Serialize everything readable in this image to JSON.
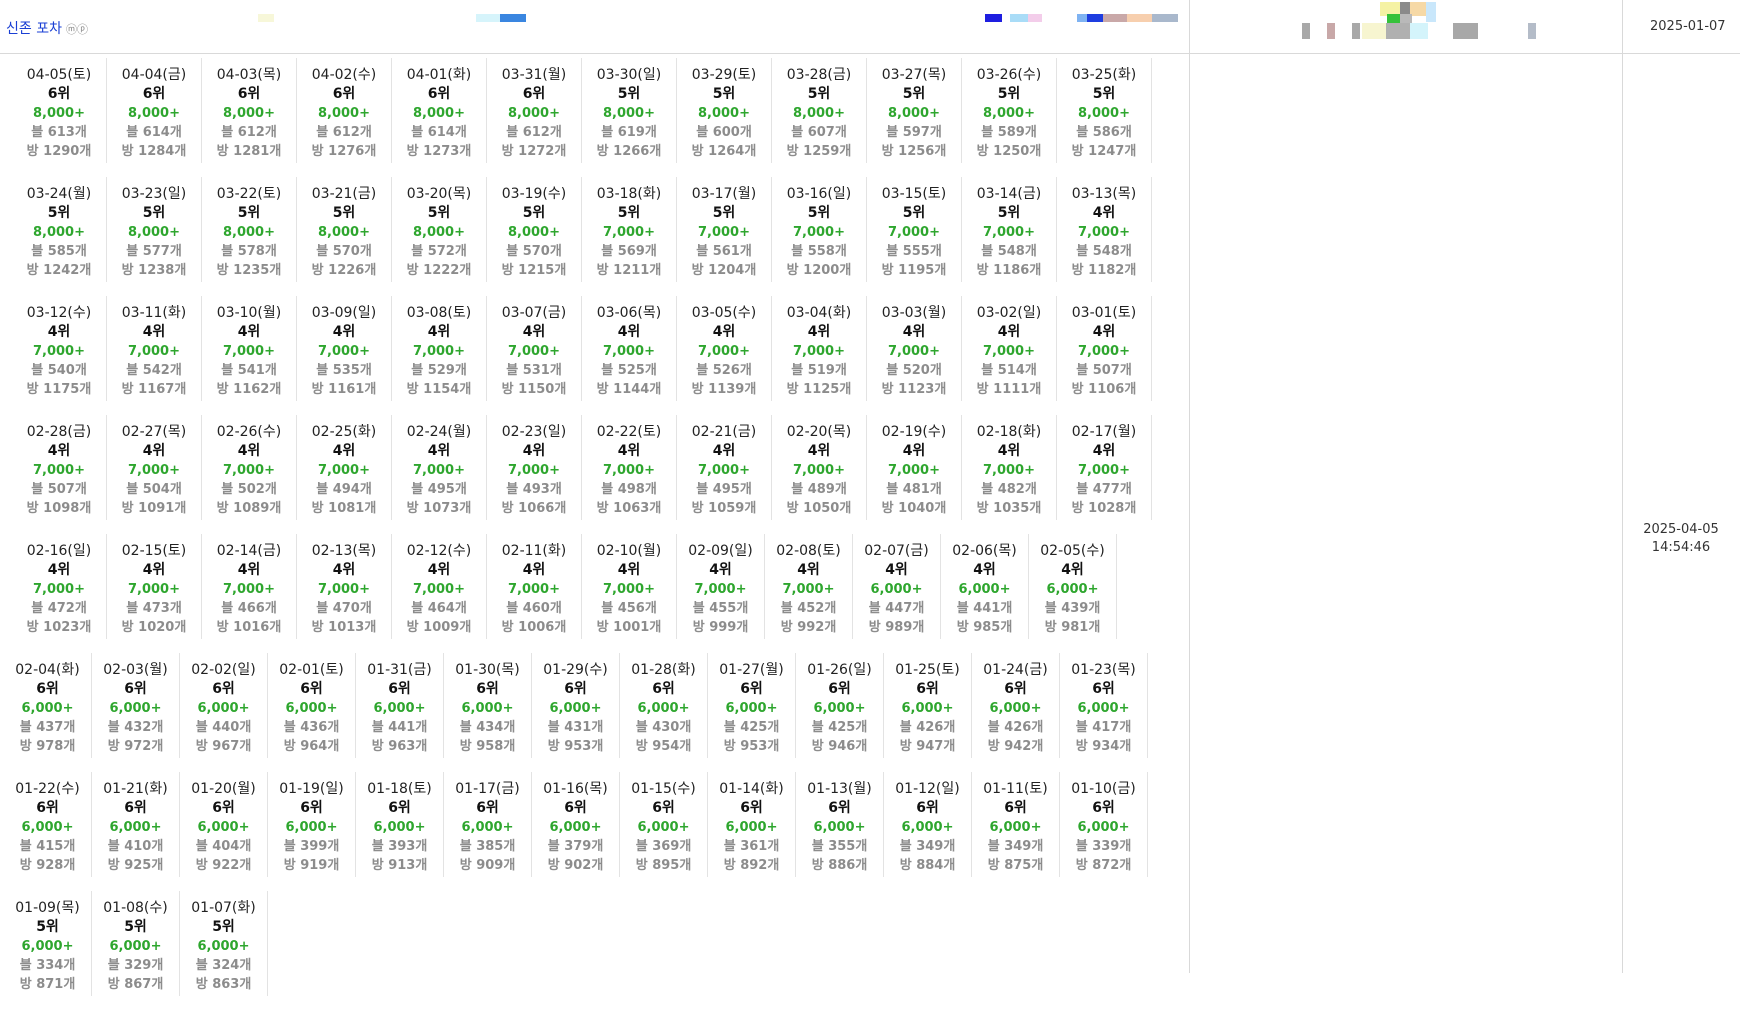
{
  "header": {
    "title": "신존 포차",
    "title_mark": "ⓜⓟ",
    "date": "2025-01-07"
  },
  "timestamp": {
    "date": "2025-04-05",
    "time": "14:54:46"
  },
  "rows": [
    [
      {
        "date": "04-05(토)",
        "rank": "6위",
        "value": "8,000+",
        "blog": "블 613개",
        "room": "방 1290개"
      },
      {
        "date": "04-04(금)",
        "rank": "6위",
        "value": "8,000+",
        "blog": "블 614개",
        "room": "방 1284개"
      },
      {
        "date": "04-03(목)",
        "rank": "6위",
        "value": "8,000+",
        "blog": "블 612개",
        "room": "방 1281개"
      },
      {
        "date": "04-02(수)",
        "rank": "6위",
        "value": "8,000+",
        "blog": "블 612개",
        "room": "방 1276개"
      },
      {
        "date": "04-01(화)",
        "rank": "6위",
        "value": "8,000+",
        "blog": "블 614개",
        "room": "방 1273개"
      },
      {
        "date": "03-31(월)",
        "rank": "6위",
        "value": "8,000+",
        "blog": "블 612개",
        "room": "방 1272개"
      },
      {
        "date": "03-30(일)",
        "rank": "5위",
        "value": "8,000+",
        "blog": "블 619개",
        "room": "방 1266개"
      },
      {
        "date": "03-29(토)",
        "rank": "5위",
        "value": "8,000+",
        "blog": "블 600개",
        "room": "방 1264개"
      },
      {
        "date": "03-28(금)",
        "rank": "5위",
        "value": "8,000+",
        "blog": "블 607개",
        "room": "방 1259개"
      },
      {
        "date": "03-27(목)",
        "rank": "5위",
        "value": "8,000+",
        "blog": "블 597개",
        "room": "방 1256개"
      },
      {
        "date": "03-26(수)",
        "rank": "5위",
        "value": "8,000+",
        "blog": "블 589개",
        "room": "방 1250개"
      },
      {
        "date": "03-25(화)",
        "rank": "5위",
        "value": "8,000+",
        "blog": "블 586개",
        "room": "방 1247개"
      }
    ],
    [
      {
        "date": "03-24(월)",
        "rank": "5위",
        "value": "8,000+",
        "blog": "블 585개",
        "room": "방 1242개"
      },
      {
        "date": "03-23(일)",
        "rank": "5위",
        "value": "8,000+",
        "blog": "블 577개",
        "room": "방 1238개"
      },
      {
        "date": "03-22(토)",
        "rank": "5위",
        "value": "8,000+",
        "blog": "블 578개",
        "room": "방 1235개"
      },
      {
        "date": "03-21(금)",
        "rank": "5위",
        "value": "8,000+",
        "blog": "블 570개",
        "room": "방 1226개"
      },
      {
        "date": "03-20(목)",
        "rank": "5위",
        "value": "8,000+",
        "blog": "블 572개",
        "room": "방 1222개"
      },
      {
        "date": "03-19(수)",
        "rank": "5위",
        "value": "8,000+",
        "blog": "블 570개",
        "room": "방 1215개"
      },
      {
        "date": "03-18(화)",
        "rank": "5위",
        "value": "7,000+",
        "blog": "블 569개",
        "room": "방 1211개"
      },
      {
        "date": "03-17(월)",
        "rank": "5위",
        "value": "7,000+",
        "blog": "블 561개",
        "room": "방 1204개"
      },
      {
        "date": "03-16(일)",
        "rank": "5위",
        "value": "7,000+",
        "blog": "블 558개",
        "room": "방 1200개"
      },
      {
        "date": "03-15(토)",
        "rank": "5위",
        "value": "7,000+",
        "blog": "블 555개",
        "room": "방 1195개"
      },
      {
        "date": "03-14(금)",
        "rank": "5위",
        "value": "7,000+",
        "blog": "블 548개",
        "room": "방 1186개"
      },
      {
        "date": "03-13(목)",
        "rank": "4위",
        "value": "7,000+",
        "blog": "블 548개",
        "room": "방 1182개"
      }
    ],
    [
      {
        "date": "03-12(수)",
        "rank": "4위",
        "value": "7,000+",
        "blog": "블 540개",
        "room": "방 1175개"
      },
      {
        "date": "03-11(화)",
        "rank": "4위",
        "value": "7,000+",
        "blog": "블 542개",
        "room": "방 1167개"
      },
      {
        "date": "03-10(월)",
        "rank": "4위",
        "value": "7,000+",
        "blog": "블 541개",
        "room": "방 1162개"
      },
      {
        "date": "03-09(일)",
        "rank": "4위",
        "value": "7,000+",
        "blog": "블 535개",
        "room": "방 1161개"
      },
      {
        "date": "03-08(토)",
        "rank": "4위",
        "value": "7,000+",
        "blog": "블 529개",
        "room": "방 1154개"
      },
      {
        "date": "03-07(금)",
        "rank": "4위",
        "value": "7,000+",
        "blog": "블 531개",
        "room": "방 1150개"
      },
      {
        "date": "03-06(목)",
        "rank": "4위",
        "value": "7,000+",
        "blog": "블 525개",
        "room": "방 1144개"
      },
      {
        "date": "03-05(수)",
        "rank": "4위",
        "value": "7,000+",
        "blog": "블 526개",
        "room": "방 1139개"
      },
      {
        "date": "03-04(화)",
        "rank": "4위",
        "value": "7,000+",
        "blog": "블 519개",
        "room": "방 1125개"
      },
      {
        "date": "03-03(월)",
        "rank": "4위",
        "value": "7,000+",
        "blog": "블 520개",
        "room": "방 1123개"
      },
      {
        "date": "03-02(일)",
        "rank": "4위",
        "value": "7,000+",
        "blog": "블 514개",
        "room": "방 1111개"
      },
      {
        "date": "03-01(토)",
        "rank": "4위",
        "value": "7,000+",
        "blog": "블 507개",
        "room": "방 1106개"
      }
    ],
    [
      {
        "date": "02-28(금)",
        "rank": "4위",
        "value": "7,000+",
        "blog": "블 507개",
        "room": "방 1098개"
      },
      {
        "date": "02-27(목)",
        "rank": "4위",
        "value": "7,000+",
        "blog": "블 504개",
        "room": "방 1091개"
      },
      {
        "date": "02-26(수)",
        "rank": "4위",
        "value": "7,000+",
        "blog": "블 502개",
        "room": "방 1089개"
      },
      {
        "date": "02-25(화)",
        "rank": "4위",
        "value": "7,000+",
        "blog": "블 494개",
        "room": "방 1081개"
      },
      {
        "date": "02-24(월)",
        "rank": "4위",
        "value": "7,000+",
        "blog": "블 495개",
        "room": "방 1073개"
      },
      {
        "date": "02-23(일)",
        "rank": "4위",
        "value": "7,000+",
        "blog": "블 493개",
        "room": "방 1066개"
      },
      {
        "date": "02-22(토)",
        "rank": "4위",
        "value": "7,000+",
        "blog": "블 498개",
        "room": "방 1063개"
      },
      {
        "date": "02-21(금)",
        "rank": "4위",
        "value": "7,000+",
        "blog": "블 495개",
        "room": "방 1059개"
      },
      {
        "date": "02-20(목)",
        "rank": "4위",
        "value": "7,000+",
        "blog": "블 489개",
        "room": "방 1050개"
      },
      {
        "date": "02-19(수)",
        "rank": "4위",
        "value": "7,000+",
        "blog": "블 481개",
        "room": "방 1040개"
      },
      {
        "date": "02-18(화)",
        "rank": "4위",
        "value": "7,000+",
        "blog": "블 482개",
        "room": "방 1035개"
      },
      {
        "date": "02-17(월)",
        "rank": "4위",
        "value": "7,000+",
        "blog": "블 477개",
        "room": "방 1028개"
      }
    ],
    [
      {
        "date": "02-16(일)",
        "rank": "4위",
        "value": "7,000+",
        "blog": "블 472개",
        "room": "방 1023개"
      },
      {
        "date": "02-15(토)",
        "rank": "4위",
        "value": "7,000+",
        "blog": "블 473개",
        "room": "방 1020개"
      },
      {
        "date": "02-14(금)",
        "rank": "4위",
        "value": "7,000+",
        "blog": "블 466개",
        "room": "방 1016개"
      },
      {
        "date": "02-13(목)",
        "rank": "4위",
        "value": "7,000+",
        "blog": "블 470개",
        "room": "방 1013개"
      },
      {
        "date": "02-12(수)",
        "rank": "4위",
        "value": "7,000+",
        "blog": "블 464개",
        "room": "방 1009개"
      },
      {
        "date": "02-11(화)",
        "rank": "4위",
        "value": "7,000+",
        "blog": "블 460개",
        "room": "방 1006개"
      },
      {
        "date": "02-10(월)",
        "rank": "4위",
        "value": "7,000+",
        "blog": "블 456개",
        "room": "방 1001개"
      },
      {
        "date": "02-09(일)",
        "rank": "4위",
        "value": "7,000+",
        "blog": "블 455개",
        "room": "방 999개"
      },
      {
        "date": "02-08(토)",
        "rank": "4위",
        "value": "7,000+",
        "blog": "블 452개",
        "room": "방 992개"
      },
      {
        "date": "02-07(금)",
        "rank": "4위",
        "value": "6,000+",
        "blog": "블 447개",
        "room": "방 989개"
      },
      {
        "date": "02-06(목)",
        "rank": "4위",
        "value": "6,000+",
        "blog": "블 441개",
        "room": "방 985개"
      },
      {
        "date": "02-05(수)",
        "rank": "4위",
        "value": "6,000+",
        "blog": "블 439개",
        "room": "방 981개"
      }
    ],
    [
      {
        "date": "02-04(화)",
        "rank": "6위",
        "value": "6,000+",
        "blog": "블 437개",
        "room": "방 978개"
      },
      {
        "date": "02-03(월)",
        "rank": "6위",
        "value": "6,000+",
        "blog": "블 432개",
        "room": "방 972개"
      },
      {
        "date": "02-02(일)",
        "rank": "6위",
        "value": "6,000+",
        "blog": "블 440개",
        "room": "방 967개"
      },
      {
        "date": "02-01(토)",
        "rank": "6위",
        "value": "6,000+",
        "blog": "블 436개",
        "room": "방 964개"
      },
      {
        "date": "01-31(금)",
        "rank": "6위",
        "value": "6,000+",
        "blog": "블 441개",
        "room": "방 963개"
      },
      {
        "date": "01-30(목)",
        "rank": "6위",
        "value": "6,000+",
        "blog": "블 434개",
        "room": "방 958개"
      },
      {
        "date": "01-29(수)",
        "rank": "6위",
        "value": "6,000+",
        "blog": "블 431개",
        "room": "방 953개"
      },
      {
        "date": "01-28(화)",
        "rank": "6위",
        "value": "6,000+",
        "blog": "블 430개",
        "room": "방 954개"
      },
      {
        "date": "01-27(월)",
        "rank": "6위",
        "value": "6,000+",
        "blog": "블 425개",
        "room": "방 953개"
      },
      {
        "date": "01-26(일)",
        "rank": "6위",
        "value": "6,000+",
        "blog": "블 425개",
        "room": "방 946개"
      },
      {
        "date": "01-25(토)",
        "rank": "6위",
        "value": "6,000+",
        "blog": "블 426개",
        "room": "방 947개"
      },
      {
        "date": "01-24(금)",
        "rank": "6위",
        "value": "6,000+",
        "blog": "블 426개",
        "room": "방 942개"
      },
      {
        "date": "01-23(목)",
        "rank": "6위",
        "value": "6,000+",
        "blog": "블 417개",
        "room": "방 934개"
      }
    ],
    [
      {
        "date": "01-22(수)",
        "rank": "6위",
        "value": "6,000+",
        "blog": "블 415개",
        "room": "방 928개"
      },
      {
        "date": "01-21(화)",
        "rank": "6위",
        "value": "6,000+",
        "blog": "블 410개",
        "room": "방 925개"
      },
      {
        "date": "01-20(월)",
        "rank": "6위",
        "value": "6,000+",
        "blog": "블 404개",
        "room": "방 922개"
      },
      {
        "date": "01-19(일)",
        "rank": "6위",
        "value": "6,000+",
        "blog": "블 399개",
        "room": "방 919개"
      },
      {
        "date": "01-18(토)",
        "rank": "6위",
        "value": "6,000+",
        "blog": "블 393개",
        "room": "방 913개"
      },
      {
        "date": "01-17(금)",
        "rank": "6위",
        "value": "6,000+",
        "blog": "블 385개",
        "room": "방 909개"
      },
      {
        "date": "01-16(목)",
        "rank": "6위",
        "value": "6,000+",
        "blog": "블 379개",
        "room": "방 902개"
      },
      {
        "date": "01-15(수)",
        "rank": "6위",
        "value": "6,000+",
        "blog": "블 369개",
        "room": "방 895개"
      },
      {
        "date": "01-14(화)",
        "rank": "6위",
        "value": "6,000+",
        "blog": "블 361개",
        "room": "방 892개"
      },
      {
        "date": "01-13(월)",
        "rank": "6위",
        "value": "6,000+",
        "blog": "블 355개",
        "room": "방 886개"
      },
      {
        "date": "01-12(일)",
        "rank": "6위",
        "value": "6,000+",
        "blog": "블 349개",
        "room": "방 884개"
      },
      {
        "date": "01-11(토)",
        "rank": "6위",
        "value": "6,000+",
        "blog": "블 349개",
        "room": "방 875개"
      },
      {
        "date": "01-10(금)",
        "rank": "6위",
        "value": "6,000+",
        "blog": "블 339개",
        "room": "방 872개"
      }
    ],
    [
      {
        "date": "01-09(목)",
        "rank": "5위",
        "value": "6,000+",
        "blog": "블 334개",
        "room": "방 871개"
      },
      {
        "date": "01-08(수)",
        "rank": "5위",
        "value": "6,000+",
        "blog": "블 329개",
        "room": "방 867개"
      },
      {
        "date": "01-07(화)",
        "rank": "5위",
        "value": "6,000+",
        "blog": "블 324개",
        "room": "방 863개"
      }
    ]
  ],
  "colors": {
    "value_green": "#2ea62e",
    "muted_gray": "#8c8c8c",
    "title_blue": "#1a3fd4"
  }
}
